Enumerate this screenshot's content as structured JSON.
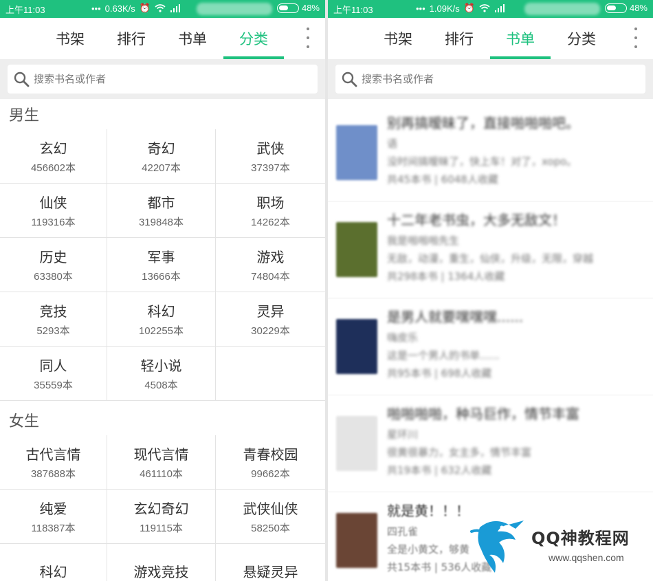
{
  "left": {
    "status": {
      "time": "上午11:03",
      "speed": "0.63K/s",
      "battery": "48%"
    },
    "tabs": [
      "书架",
      "排行",
      "书单",
      "分类"
    ],
    "active_tab": 3,
    "search": {
      "placeholder": "搜索书名或作者"
    },
    "male": {
      "title": "男生",
      "categories": [
        {
          "name": "玄幻",
          "count": "456602本"
        },
        {
          "name": "奇幻",
          "count": "42207本"
        },
        {
          "name": "武侠",
          "count": "37397本"
        },
        {
          "name": "仙侠",
          "count": "119316本"
        },
        {
          "name": "都市",
          "count": "319848本"
        },
        {
          "name": "职场",
          "count": "14262本"
        },
        {
          "name": "历史",
          "count": "63380本"
        },
        {
          "name": "军事",
          "count": "13666本"
        },
        {
          "name": "游戏",
          "count": "74804本"
        },
        {
          "name": "竞技",
          "count": "5293本"
        },
        {
          "name": "科幻",
          "count": "102255本"
        },
        {
          "name": "灵异",
          "count": "30229本"
        },
        {
          "name": "同人",
          "count": "35559本"
        },
        {
          "name": "轻小说",
          "count": "4508本"
        }
      ]
    },
    "female": {
      "title": "女生",
      "categories": [
        {
          "name": "古代言情",
          "count": "387688本"
        },
        {
          "name": "现代言情",
          "count": "461110本"
        },
        {
          "name": "青春校园",
          "count": "99662本"
        },
        {
          "name": "纯爱",
          "count": "118387本"
        },
        {
          "name": "玄幻奇幻",
          "count": "119115本"
        },
        {
          "name": "武侠仙侠",
          "count": "58250本"
        },
        {
          "name": "科幻",
          "count": ""
        },
        {
          "name": "游戏竞技",
          "count": ""
        },
        {
          "name": "悬疑灵异",
          "count": ""
        }
      ]
    }
  },
  "right": {
    "status": {
      "time": "上午11:03",
      "speed": "1.09K/s",
      "battery": "48%"
    },
    "tabs": [
      "书架",
      "排行",
      "书单",
      "分类"
    ],
    "active_tab": 2,
    "search": {
      "placeholder": "搜索书名或作者"
    },
    "booklists": [
      {
        "title": "别再搞暧昧了，直接啪啪啪吧。",
        "author": "语",
        "desc": "没时间搞暧昧了，快上车！对了，xopo。",
        "meta": "共45本书 | 6048人收藏",
        "cover": "#6f8fc9"
      },
      {
        "title": "十二年老书虫，大多无敌文！",
        "author": "我是啪啪啪先生",
        "desc": "无敌，动漫，重生，仙侠，升级，无限，穿越",
        "meta": "共298本书 | 1364人收藏",
        "cover": "#5b6f2e"
      },
      {
        "title": "是男人就要嘿嘿嘿......",
        "author": "嗨皮乐",
        "desc": "这是一个男人的书单......",
        "meta": "共95本书 | 698人收藏",
        "cover": "#1e2f5a"
      },
      {
        "title": "啪啪啪啪，种马巨作，情节丰富",
        "author": "星环川",
        "desc": "很黄很暴力，女主多，情节丰富",
        "meta": "共19本书 | 632人收藏",
        "cover": "#e4e4e4"
      },
      {
        "title": "就是黄！！！",
        "author": "四孔雀",
        "desc": "全是小黄文，够黄",
        "meta": "共15本书 | 536人收藏",
        "cover": "#6a4535"
      }
    ]
  },
  "watermark": {
    "title": "QQ神教程网",
    "url": "www.qqshen.com"
  }
}
